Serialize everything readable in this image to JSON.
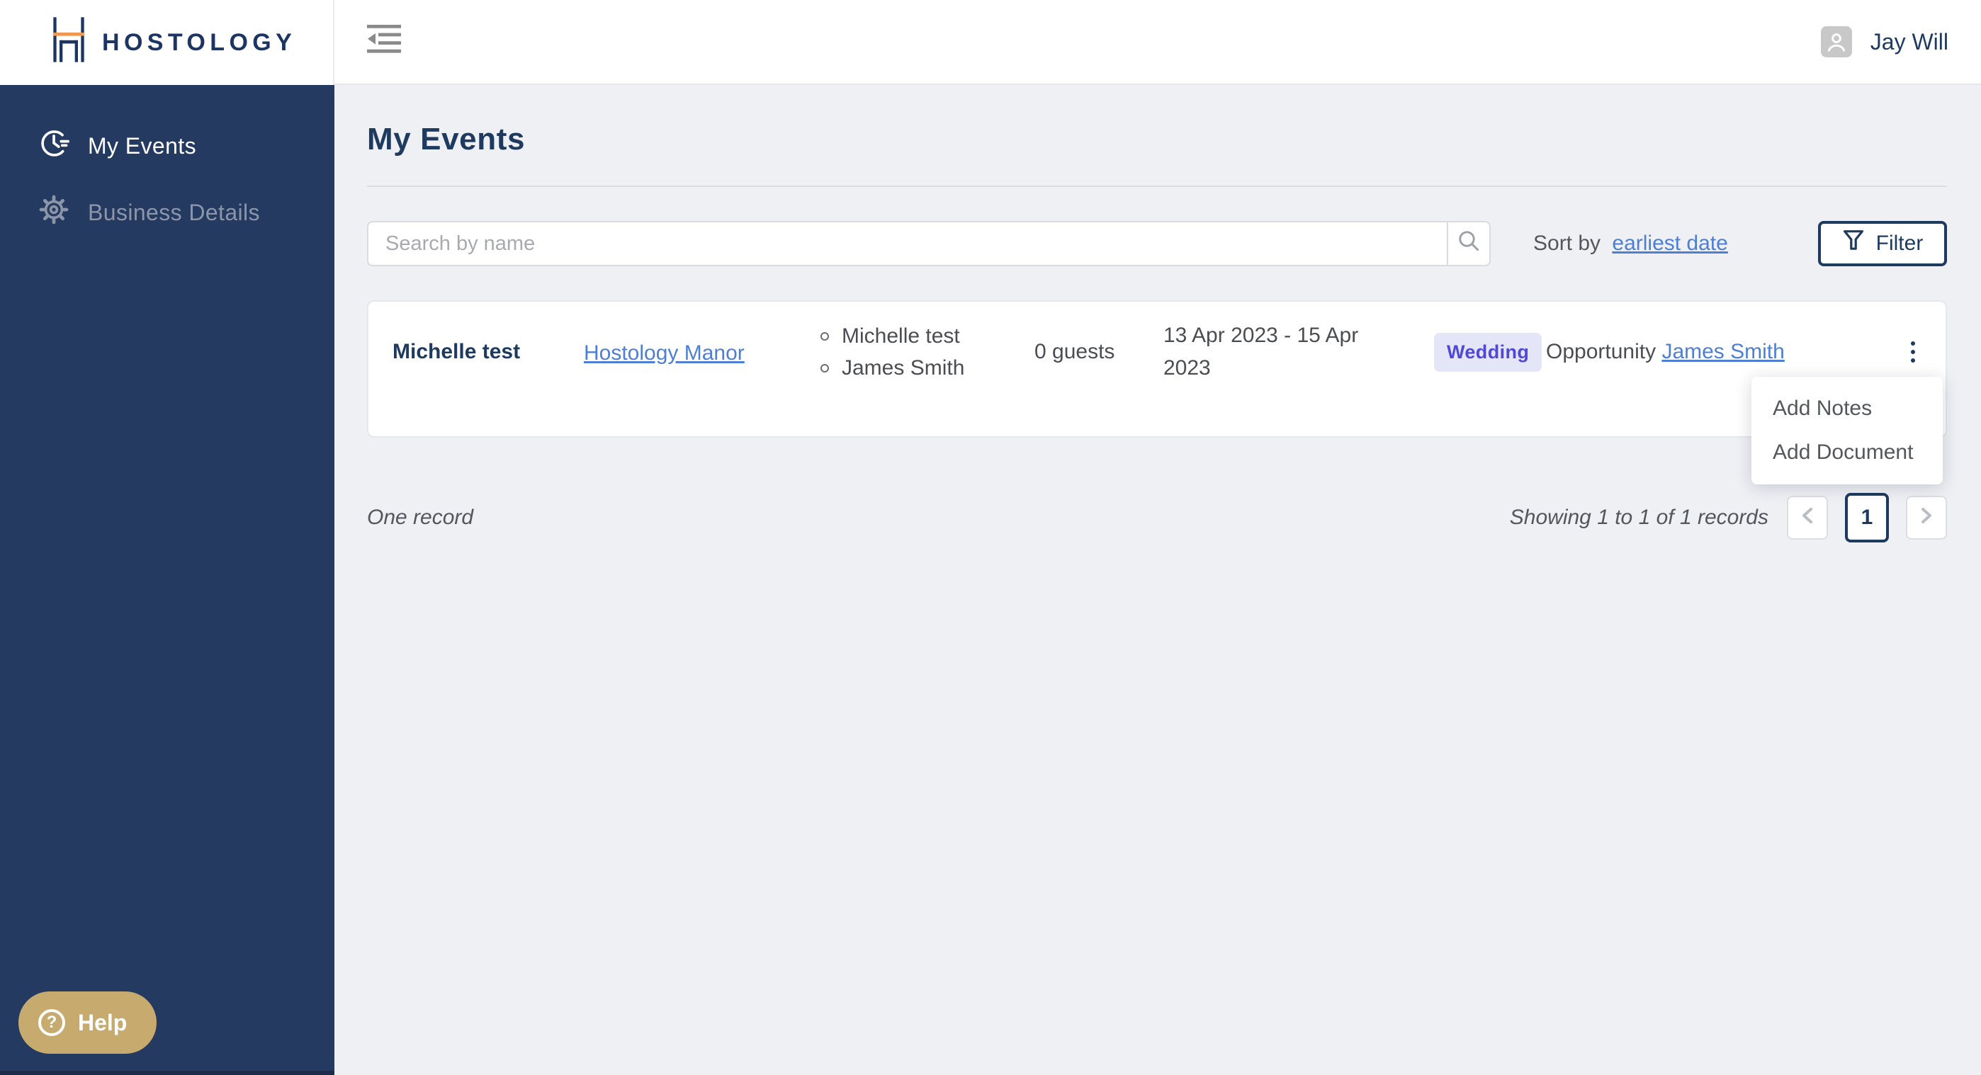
{
  "brand": {
    "logo_text": "HOSTOLOGY"
  },
  "header": {
    "user_name": "Jay Will"
  },
  "sidebar": {
    "items": [
      {
        "label": "My Events",
        "icon": "clock-icon",
        "active": true
      },
      {
        "label": "Business Details",
        "icon": "gear-icon",
        "active": false
      }
    ],
    "help_label": "Help",
    "help_icon_glyph": "?"
  },
  "page": {
    "title": "My Events"
  },
  "toolbar": {
    "search_placeholder": "Search by name",
    "sort_label": "Sort by",
    "sort_value": "earliest date",
    "filter_label": "Filter"
  },
  "events": [
    {
      "name": "Michelle test",
      "venue": "Hostology Manor",
      "contacts": [
        "Michelle test",
        "James Smith"
      ],
      "guests": "0 guests",
      "dates": "13 Apr 2023 - 15 Apr 2023",
      "type_badge": "Wedding",
      "opportunity_label": "Opportunity",
      "opportunity_contact": "James Smith"
    }
  ],
  "row_menu": {
    "items": [
      "Add Notes",
      "Add Document"
    ]
  },
  "footer": {
    "summary": "One record",
    "showing": "Showing 1 to 1 of 1 records",
    "page": "1"
  },
  "colors": {
    "sidebar_navy": "#243a60",
    "text_navy": "#1e3a5f",
    "logo_orange": "#f0964f",
    "link_blue": "#4f7fd3",
    "badge_bg": "#e5e5f8",
    "badge_text": "#5047d8",
    "help_gold": "#c7aa6e",
    "main_bg": "#eef0f4"
  }
}
